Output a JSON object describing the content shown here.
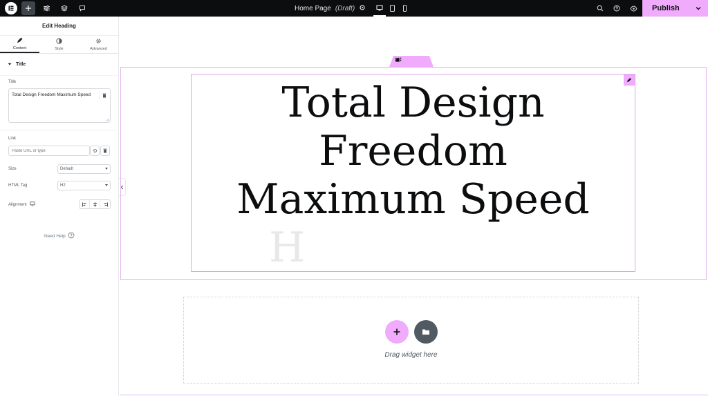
{
  "topbar": {
    "page_name": "Home Page",
    "page_status": "(Draft)",
    "publish_label": "Publish"
  },
  "panel": {
    "header_title": "Edit Heading",
    "tabs": [
      {
        "label": "Content",
        "icon": "pencil-icon",
        "active": true
      },
      {
        "label": "Style",
        "icon": "contrast-icon",
        "active": false
      },
      {
        "label": "Advanced",
        "icon": "gear-icon",
        "active": false
      }
    ],
    "section_title": "Title",
    "title_field_label": "Title",
    "title_value": "Total Design Freedom Maximum Speed",
    "link_label": "Link",
    "link_placeholder": "Paste URL or type",
    "size_label": "Size",
    "size_value": "Default",
    "html_tag_label": "HTML Tag",
    "html_tag_value": "H2",
    "alignment_label": "Alignment",
    "need_help": "Need Help"
  },
  "canvas": {
    "heading_lines": [
      "Total Design",
      "Freedom",
      "Maximum Speed"
    ],
    "ghost_letter": "H",
    "drag_text": "Drag widget here"
  },
  "colors": {
    "accent": "#f0abfc",
    "topbar_bg": "#0c0d0e",
    "selection_border": "#e6b6ef"
  }
}
